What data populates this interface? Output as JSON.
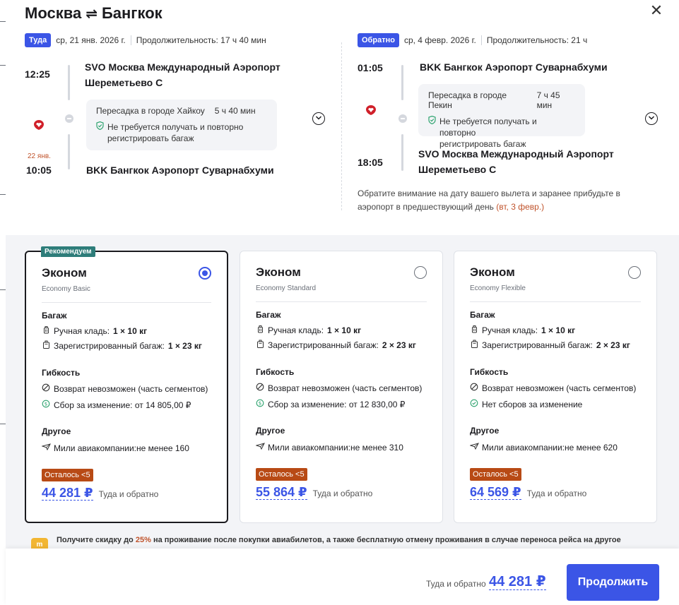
{
  "title": {
    "from": "Москва",
    "to": "Бангкок",
    "arrow": "⇌"
  },
  "outbound": {
    "direction": "Туда",
    "date": "ср, 21 янв. 2026 г.",
    "duration": "Продолжительность: 17 ч 40 мин",
    "dep_time": "12:25",
    "dep_airport_line1": "SVO Москва Международный Аэропорт",
    "dep_airport_line2": "Шереметьево С",
    "arr_date": "22 янв.",
    "arr_time": "10:05",
    "arr_airport": "BKK Бангкок Аэропорт Суварнабхуми",
    "transfer_city": "Пересадка в городе Хайкоу",
    "transfer_time": "5 ч 40 мин",
    "transfer_note_line1": "Не требуется получать и повторно",
    "transfer_note_line2": "регистрировать багаж"
  },
  "inbound": {
    "direction": "Обратно",
    "date": "ср, 4 февр. 2026 г.",
    "duration": "Продолжительность: 21 ч",
    "dep_time": "01:05",
    "dep_airport": "BKK Бангкок Аэропорт Суварнабхуми",
    "arr_time": "18:05",
    "arr_airport_line1": "SVO Москва Международный Аэропорт",
    "arr_airport_line2": "Шереметьево С",
    "transfer_city": "Пересадка в городе Пекин",
    "transfer_time": "7 ч 45 мин",
    "transfer_note_line1": "Не требуется получать и повторно",
    "transfer_note_line2": "регистрировать багаж",
    "notice_line1": "Обратите внимание на дату вашего вылета и заранее прибудьте в",
    "notice_line2": "аэропорт в предшествующий день",
    "notice_date": "(вт, 3 февр.)"
  },
  "fares": [
    {
      "tag": "Рекомендуем",
      "name": "Эконом",
      "sub": "Economy Basic",
      "selected": true,
      "baggage_title": "Багаж",
      "carry_label": "Ручная кладь:",
      "carry_value": "1 × 10 кг",
      "checked_label": "Зарегистрированный багаж:",
      "checked_value": "1 × 23 кг",
      "flex_title": "Гибкость",
      "refund": "Возврат невозможен (часть сегментов)",
      "change": "Сбор за изменение: от 14 805,00 ₽",
      "other_title": "Другое",
      "miles": "Мили авиакомпании:не менее 160",
      "left": "Осталось <5",
      "price": "44 281 ₽",
      "price_note": "Туда и обратно"
    },
    {
      "name": "Эконом",
      "sub": "Economy Standard",
      "selected": false,
      "baggage_title": "Багаж",
      "carry_label": "Ручная кладь:",
      "carry_value": "1 × 10 кг",
      "checked_label": "Зарегистрированный багаж:",
      "checked_value": "2 × 23 кг",
      "flex_title": "Гибкость",
      "refund": "Возврат невозможен (часть сегментов)",
      "change": "Сбор за изменение: от 12 830,00 ₽",
      "other_title": "Другое",
      "miles": "Мили авиакомпании:не менее 310",
      "left": "Осталось <5",
      "price": "55 864 ₽",
      "price_note": "Туда и обратно"
    },
    {
      "name": "Эконом",
      "sub": "Economy Flexible",
      "selected": false,
      "baggage_title": "Багаж",
      "carry_label": "Ручная кладь:",
      "carry_value": "1 × 10 кг",
      "checked_label": "Зарегистрированный багаж:",
      "checked_value": "2 × 23 кг",
      "flex_title": "Гибкость",
      "refund": "Возврат невозможен (часть сегментов)",
      "change": "Нет сборов за изменение",
      "other_title": "Другое",
      "miles": "Мили авиакомпании:не менее 620",
      "left": "Осталось <5",
      "price": "64 569 ₽",
      "price_note": "Туда и обратно"
    }
  ],
  "promo": {
    "before": "Получите скидку до",
    "pct": "25%",
    "after": "на проживание после покупки авиабилетов, а также бесплатную отмену проживания в случае переноса рейса на другое"
  },
  "footer": {
    "note": "Туда и обратно",
    "price": "44 281 ₽",
    "button": "Продолжить"
  },
  "colors": {
    "accent": "#3b55e6",
    "recommend": "#2e7d7a",
    "urgency": "#b84a15",
    "highlight": "#c0532b"
  },
  "icons": [
    "close-icon",
    "swap-arrows-icon",
    "airline-logo-icon",
    "shield-check-icon",
    "chevron-down-icon",
    "carry-on-bag-icon",
    "checked-bag-icon",
    "no-refund-icon",
    "change-fee-icon",
    "check-circle-icon",
    "miles-icon",
    "hotel-promo-icon"
  ]
}
